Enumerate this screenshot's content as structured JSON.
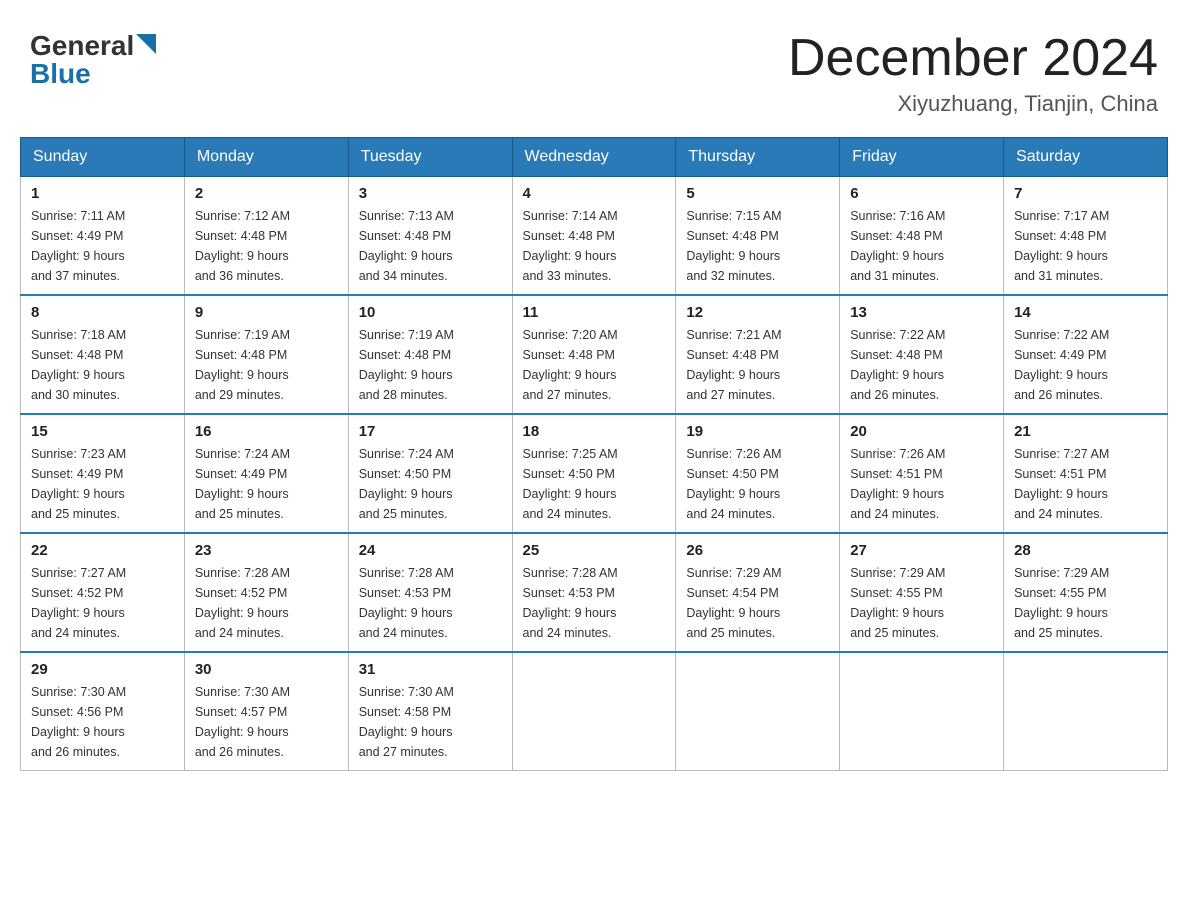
{
  "header": {
    "logo_general": "General",
    "logo_blue": "Blue",
    "month_year": "December 2024",
    "location": "Xiyuzhuang, Tianjin, China"
  },
  "weekdays": [
    "Sunday",
    "Monday",
    "Tuesday",
    "Wednesday",
    "Thursday",
    "Friday",
    "Saturday"
  ],
  "weeks": [
    [
      {
        "day": "1",
        "sunrise": "7:11 AM",
        "sunset": "4:49 PM",
        "daylight": "9 hours and 37 minutes."
      },
      {
        "day": "2",
        "sunrise": "7:12 AM",
        "sunset": "4:48 PM",
        "daylight": "9 hours and 36 minutes."
      },
      {
        "day": "3",
        "sunrise": "7:13 AM",
        "sunset": "4:48 PM",
        "daylight": "9 hours and 34 minutes."
      },
      {
        "day": "4",
        "sunrise": "7:14 AM",
        "sunset": "4:48 PM",
        "daylight": "9 hours and 33 minutes."
      },
      {
        "day": "5",
        "sunrise": "7:15 AM",
        "sunset": "4:48 PM",
        "daylight": "9 hours and 32 minutes."
      },
      {
        "day": "6",
        "sunrise": "7:16 AM",
        "sunset": "4:48 PM",
        "daylight": "9 hours and 31 minutes."
      },
      {
        "day": "7",
        "sunrise": "7:17 AM",
        "sunset": "4:48 PM",
        "daylight": "9 hours and 31 minutes."
      }
    ],
    [
      {
        "day": "8",
        "sunrise": "7:18 AM",
        "sunset": "4:48 PM",
        "daylight": "9 hours and 30 minutes."
      },
      {
        "day": "9",
        "sunrise": "7:19 AM",
        "sunset": "4:48 PM",
        "daylight": "9 hours and 29 minutes."
      },
      {
        "day": "10",
        "sunrise": "7:19 AM",
        "sunset": "4:48 PM",
        "daylight": "9 hours and 28 minutes."
      },
      {
        "day": "11",
        "sunrise": "7:20 AM",
        "sunset": "4:48 PM",
        "daylight": "9 hours and 27 minutes."
      },
      {
        "day": "12",
        "sunrise": "7:21 AM",
        "sunset": "4:48 PM",
        "daylight": "9 hours and 27 minutes."
      },
      {
        "day": "13",
        "sunrise": "7:22 AM",
        "sunset": "4:48 PM",
        "daylight": "9 hours and 26 minutes."
      },
      {
        "day": "14",
        "sunrise": "7:22 AM",
        "sunset": "4:49 PM",
        "daylight": "9 hours and 26 minutes."
      }
    ],
    [
      {
        "day": "15",
        "sunrise": "7:23 AM",
        "sunset": "4:49 PM",
        "daylight": "9 hours and 25 minutes."
      },
      {
        "day": "16",
        "sunrise": "7:24 AM",
        "sunset": "4:49 PM",
        "daylight": "9 hours and 25 minutes."
      },
      {
        "day": "17",
        "sunrise": "7:24 AM",
        "sunset": "4:50 PM",
        "daylight": "9 hours and 25 minutes."
      },
      {
        "day": "18",
        "sunrise": "7:25 AM",
        "sunset": "4:50 PM",
        "daylight": "9 hours and 24 minutes."
      },
      {
        "day": "19",
        "sunrise": "7:26 AM",
        "sunset": "4:50 PM",
        "daylight": "9 hours and 24 minutes."
      },
      {
        "day": "20",
        "sunrise": "7:26 AM",
        "sunset": "4:51 PM",
        "daylight": "9 hours and 24 minutes."
      },
      {
        "day": "21",
        "sunrise": "7:27 AM",
        "sunset": "4:51 PM",
        "daylight": "9 hours and 24 minutes."
      }
    ],
    [
      {
        "day": "22",
        "sunrise": "7:27 AM",
        "sunset": "4:52 PM",
        "daylight": "9 hours and 24 minutes."
      },
      {
        "day": "23",
        "sunrise": "7:28 AM",
        "sunset": "4:52 PM",
        "daylight": "9 hours and 24 minutes."
      },
      {
        "day": "24",
        "sunrise": "7:28 AM",
        "sunset": "4:53 PM",
        "daylight": "9 hours and 24 minutes."
      },
      {
        "day": "25",
        "sunrise": "7:28 AM",
        "sunset": "4:53 PM",
        "daylight": "9 hours and 24 minutes."
      },
      {
        "day": "26",
        "sunrise": "7:29 AM",
        "sunset": "4:54 PM",
        "daylight": "9 hours and 25 minutes."
      },
      {
        "day": "27",
        "sunrise": "7:29 AM",
        "sunset": "4:55 PM",
        "daylight": "9 hours and 25 minutes."
      },
      {
        "day": "28",
        "sunrise": "7:29 AM",
        "sunset": "4:55 PM",
        "daylight": "9 hours and 25 minutes."
      }
    ],
    [
      {
        "day": "29",
        "sunrise": "7:30 AM",
        "sunset": "4:56 PM",
        "daylight": "9 hours and 26 minutes."
      },
      {
        "day": "30",
        "sunrise": "7:30 AM",
        "sunset": "4:57 PM",
        "daylight": "9 hours and 26 minutes."
      },
      {
        "day": "31",
        "sunrise": "7:30 AM",
        "sunset": "4:58 PM",
        "daylight": "9 hours and 27 minutes."
      },
      null,
      null,
      null,
      null
    ]
  ],
  "labels": {
    "sunrise": "Sunrise:",
    "sunset": "Sunset:",
    "daylight": "Daylight:"
  }
}
